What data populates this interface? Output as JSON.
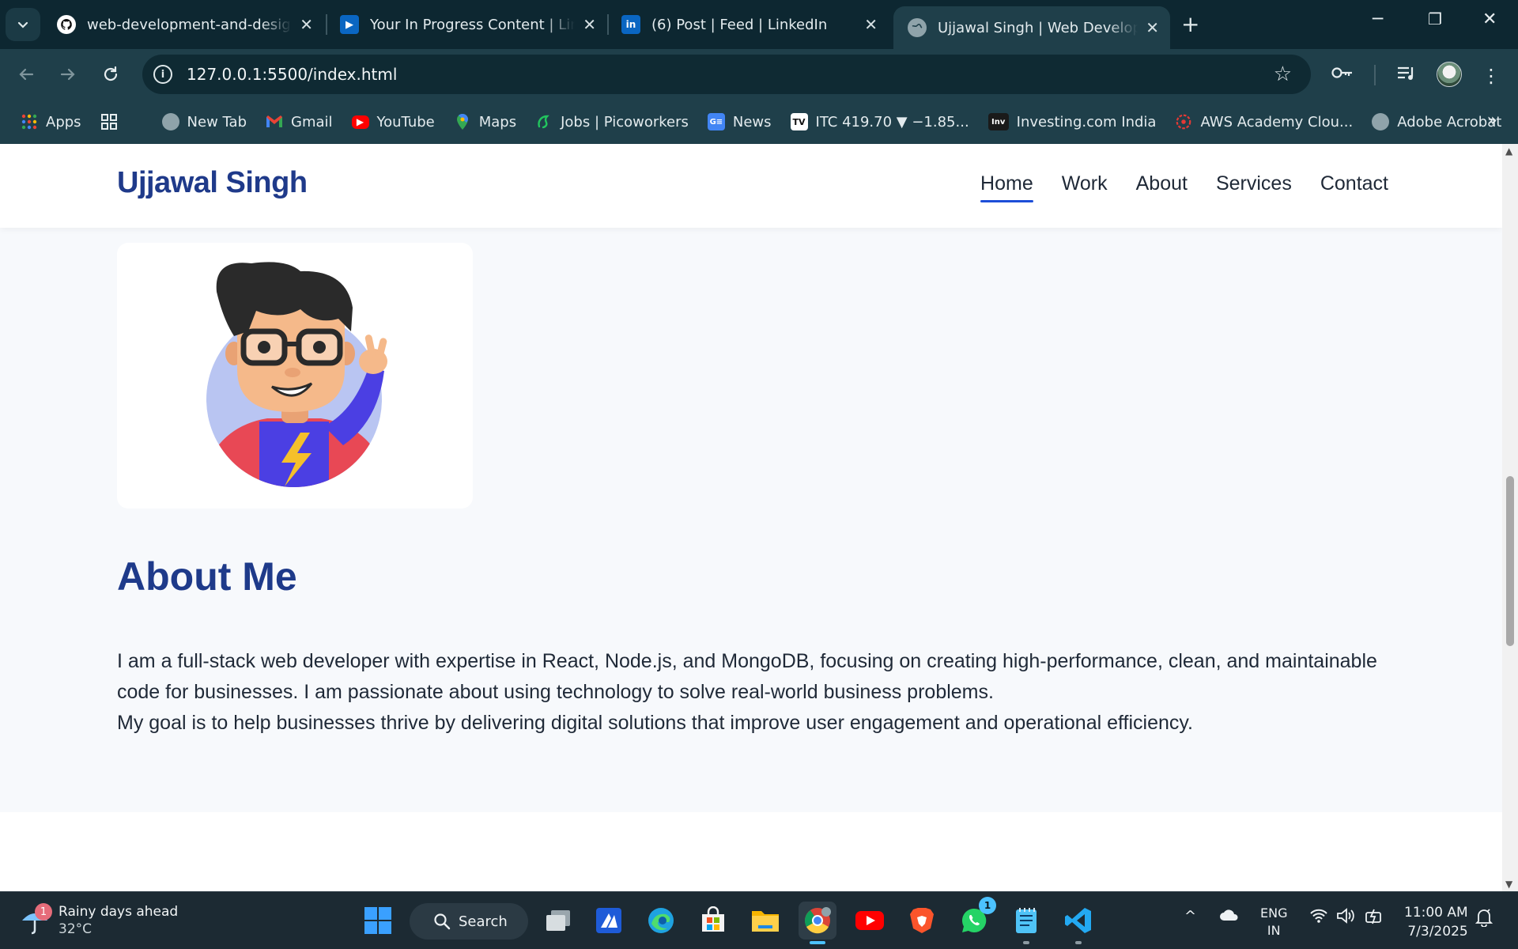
{
  "browser": {
    "tabs": [
      {
        "title": "web-development-and-design-",
        "favicon": "github-icon"
      },
      {
        "title": "Your In Progress Content | Linke",
        "favicon": "linkedin-learning-icon"
      },
      {
        "title": "(6) Post | Feed | LinkedIn",
        "favicon": "linkedin-icon"
      },
      {
        "title": "Ujjawal Singh | Web Developer | ",
        "favicon": "globe-icon"
      }
    ],
    "url": "127.0.0.1:5500/index.html"
  },
  "bookmarks": [
    {
      "label": "Apps",
      "icon": "apps-grid-icon"
    },
    {
      "label": "New Tab",
      "icon": "globe-icon"
    },
    {
      "label": "Gmail",
      "icon": "gmail-icon"
    },
    {
      "label": "YouTube",
      "icon": "youtube-icon"
    },
    {
      "label": "Maps",
      "icon": "maps-icon"
    },
    {
      "label": "Jobs | Picoworkers",
      "icon": "picoworkers-icon"
    },
    {
      "label": "News",
      "icon": "news-icon"
    },
    {
      "label": "ITC 419.70 ▼ −1.85...",
      "icon": "tradingview-icon"
    },
    {
      "label": "Investing.com India",
      "icon": "investing-icon"
    },
    {
      "label": "AWS Academy Clou...",
      "icon": "aws-academy-icon"
    },
    {
      "label": "Adobe Acrobat",
      "icon": "globe-icon"
    }
  ],
  "site": {
    "logo": "Ujjawal Singh",
    "nav": [
      "Home",
      "Work",
      "About",
      "Services",
      "Contact"
    ],
    "active_nav": "Home",
    "about": {
      "title": "About Me",
      "paragraph1": "I am a full-stack web developer with expertise in React, Node.js, and MongoDB, focusing on creating high-performance, clean, and maintainable code for businesses. I am passionate about using technology to solve real-world business problems.",
      "paragraph2": "My goal is to help businesses thrive by delivering digital solutions that improve user engagement and operational efficiency."
    }
  },
  "taskbar": {
    "weather_badge": "1",
    "weather_title": "Rainy days ahead",
    "weather_temp": "32°C",
    "search_label": "Search",
    "whatsapp_badge": "1",
    "lang_line1": "ENG",
    "lang_line2": "IN",
    "time": "11:00 AM",
    "date": "7/3/2025"
  },
  "colors": {
    "brand_blue": "#1e3a8a",
    "active_underline": "#1d4ed8",
    "browser_frame": "#1f3f4a"
  }
}
